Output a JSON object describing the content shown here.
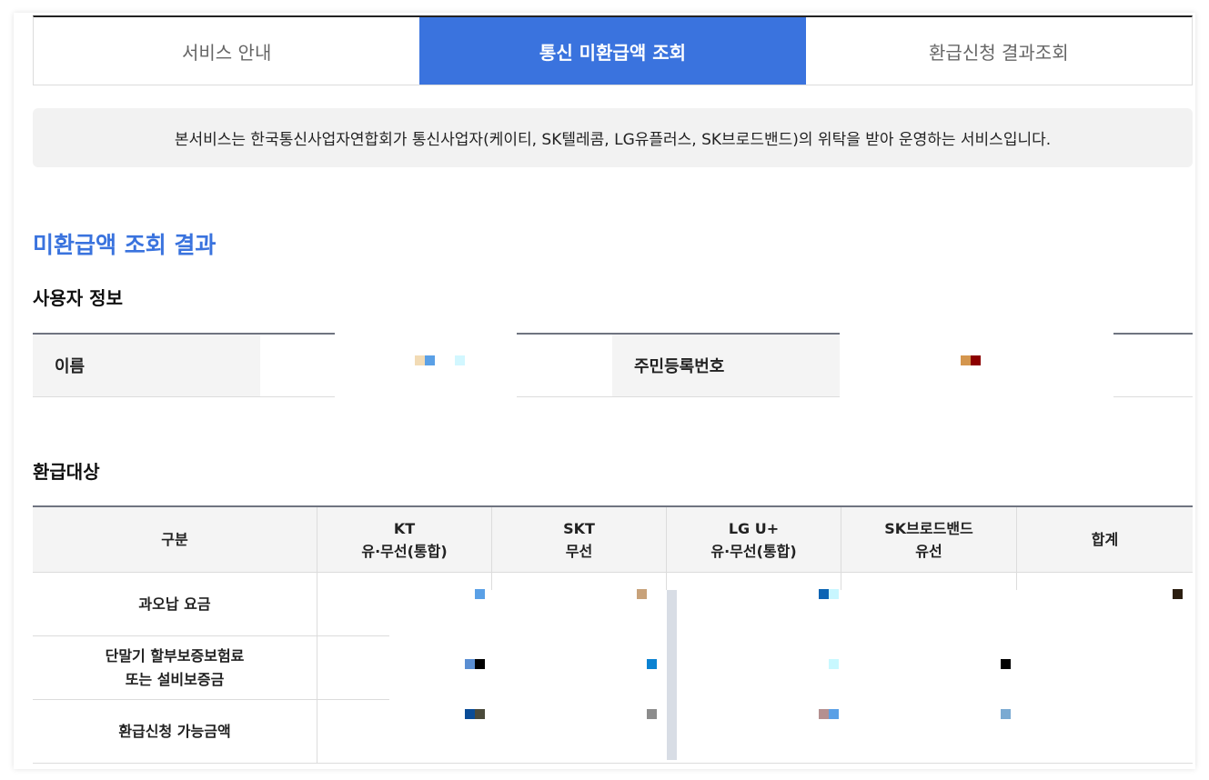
{
  "tabs": [
    {
      "label": "서비스 안내",
      "active": false
    },
    {
      "label": "통신 미환급액 조회",
      "active": true
    },
    {
      "label": "환급신청 결과조회",
      "active": false
    }
  ],
  "notice": "본서비스는 한국통신사업자연합회가 통신사업자(케이티, SK텔레콤, LG유플러스, SK브로드밴드)의 위탁을 받아 운영하는 서비스입니다.",
  "result_title": "미환급액 조회 결과",
  "user_info": {
    "title": "사용자 정보",
    "name_label": "이름",
    "rrn_label": "주민등록번호"
  },
  "refund": {
    "title": "환급대상",
    "headers": [
      {
        "line1": "구분",
        "line2": ""
      },
      {
        "line1": "KT",
        "line2": "유·무선(통합)"
      },
      {
        "line1": "SKT",
        "line2": "무선"
      },
      {
        "line1": "LG U+",
        "line2": "유·무선(통합)"
      },
      {
        "line1": "SK브로드밴드",
        "line2": "유선"
      },
      {
        "line1": "합계",
        "line2": ""
      }
    ],
    "rows": [
      {
        "line1": "과오납 요금",
        "line2": ""
      },
      {
        "line1": "단말기 할부보증보험료",
        "line2": "또는 설비보증금"
      },
      {
        "line1": "환급신청 가능금액",
        "line2": ""
      }
    ]
  },
  "colors": {
    "accent": "#3a73de",
    "active_tab_text": "#ffffff"
  }
}
